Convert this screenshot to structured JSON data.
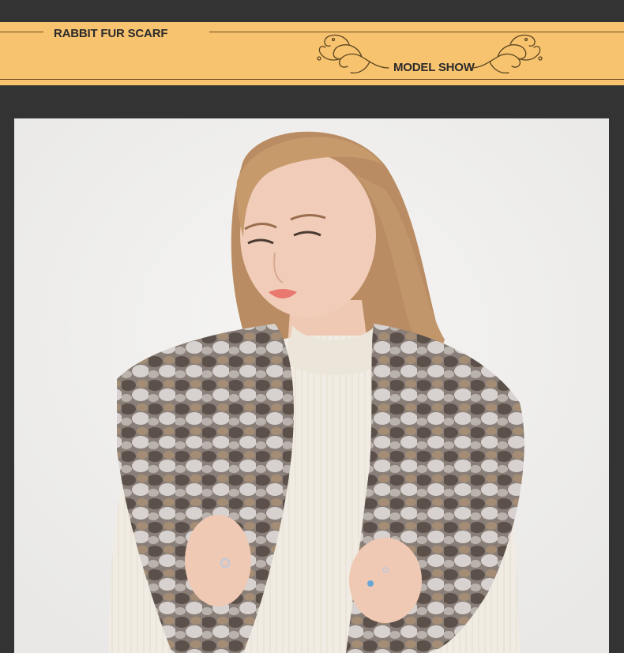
{
  "banner": {
    "title_left": "RABBIT FUR SCARF",
    "title_right": "MODEL SHOW",
    "background_color": "#f8c36f",
    "text_color": "#2b2b2b"
  },
  "page": {
    "background_color": "#333333"
  },
  "photo": {
    "icon": "model-photo",
    "background_color": "#f1f0ee"
  }
}
